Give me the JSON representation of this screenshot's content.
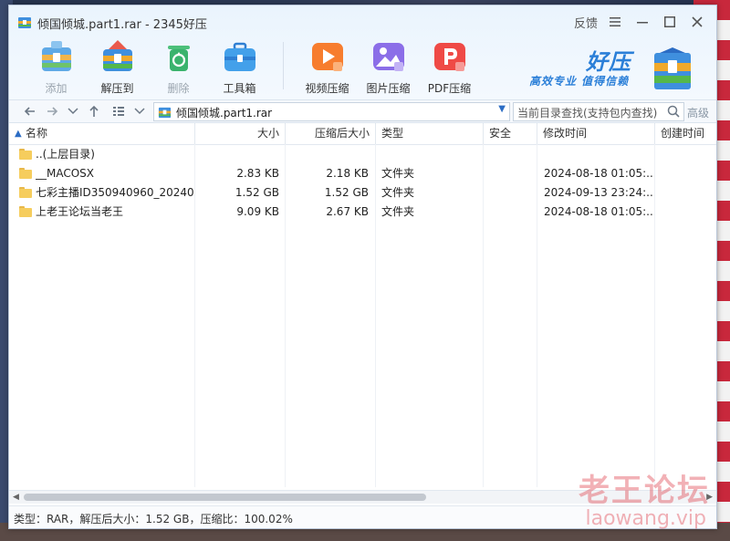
{
  "window": {
    "title": "倾国倾城.part1.rar - 2345好压",
    "feedback_label": "反馈",
    "menu_icon": "hamburger-icon",
    "minimize_icon": "minimize-icon",
    "maximize_icon": "maximize-icon",
    "close_icon": "close-icon"
  },
  "toolbar": {
    "items": [
      {
        "label": "添加",
        "icon": "add-archive-icon",
        "enabled": false
      },
      {
        "label": "解压到",
        "icon": "extract-icon",
        "enabled": true
      },
      {
        "label": "删除",
        "icon": "recycle-delete-icon",
        "enabled": false
      },
      {
        "label": "工具箱",
        "icon": "toolbox-icon",
        "enabled": true
      },
      {
        "label": "视频压缩",
        "icon": "video-compress-icon",
        "enabled": true
      },
      {
        "label": "图片压缩",
        "icon": "image-compress-icon",
        "enabled": true
      },
      {
        "label": "PDF压缩",
        "icon": "pdf-compress-icon",
        "enabled": true
      }
    ]
  },
  "brand": {
    "name": "好压",
    "slogan": "高效专业  值得信赖"
  },
  "navbar": {
    "path": "倾国倾城.part1.rar",
    "search_placeholder": "当前目录查找(支持包内查找)",
    "advanced_label": "高级"
  },
  "table": {
    "columns": [
      "名称",
      "大小",
      "压缩后大小",
      "类型",
      "安全",
      "修改时间",
      "创建时间"
    ],
    "rows": [
      {
        "name": "..(上层目录)",
        "size": "",
        "packed": "",
        "type": "",
        "security": "",
        "modified": "",
        "created": ""
      },
      {
        "name": "__MACOSX",
        "size": "2.83 KB",
        "packed": "2.18 KB",
        "type": "文件夹",
        "security": "",
        "modified": "2024-08-18 01:05:...",
        "created": ""
      },
      {
        "name": "七彩主播ID350940960_20240...",
        "size": "1.52 GB",
        "packed": "1.52 GB",
        "type": "文件夹",
        "security": "",
        "modified": "2024-09-13 23:24:...",
        "created": ""
      },
      {
        "name": "上老王论坛当老王",
        "size": "9.09 KB",
        "packed": "2.67 KB",
        "type": "文件夹",
        "security": "",
        "modified": "2024-08-18 01:05:...",
        "created": ""
      }
    ]
  },
  "status": {
    "text": "类型：RAR，解压后大小：1.52 GB，压缩比：100.02%"
  },
  "watermark": {
    "line1": "老王论坛",
    "line2": "laowang.vip"
  },
  "colors": {
    "accent": "#2b7fd8",
    "folder": "#f6cd5d",
    "watermark": "#e14650"
  }
}
